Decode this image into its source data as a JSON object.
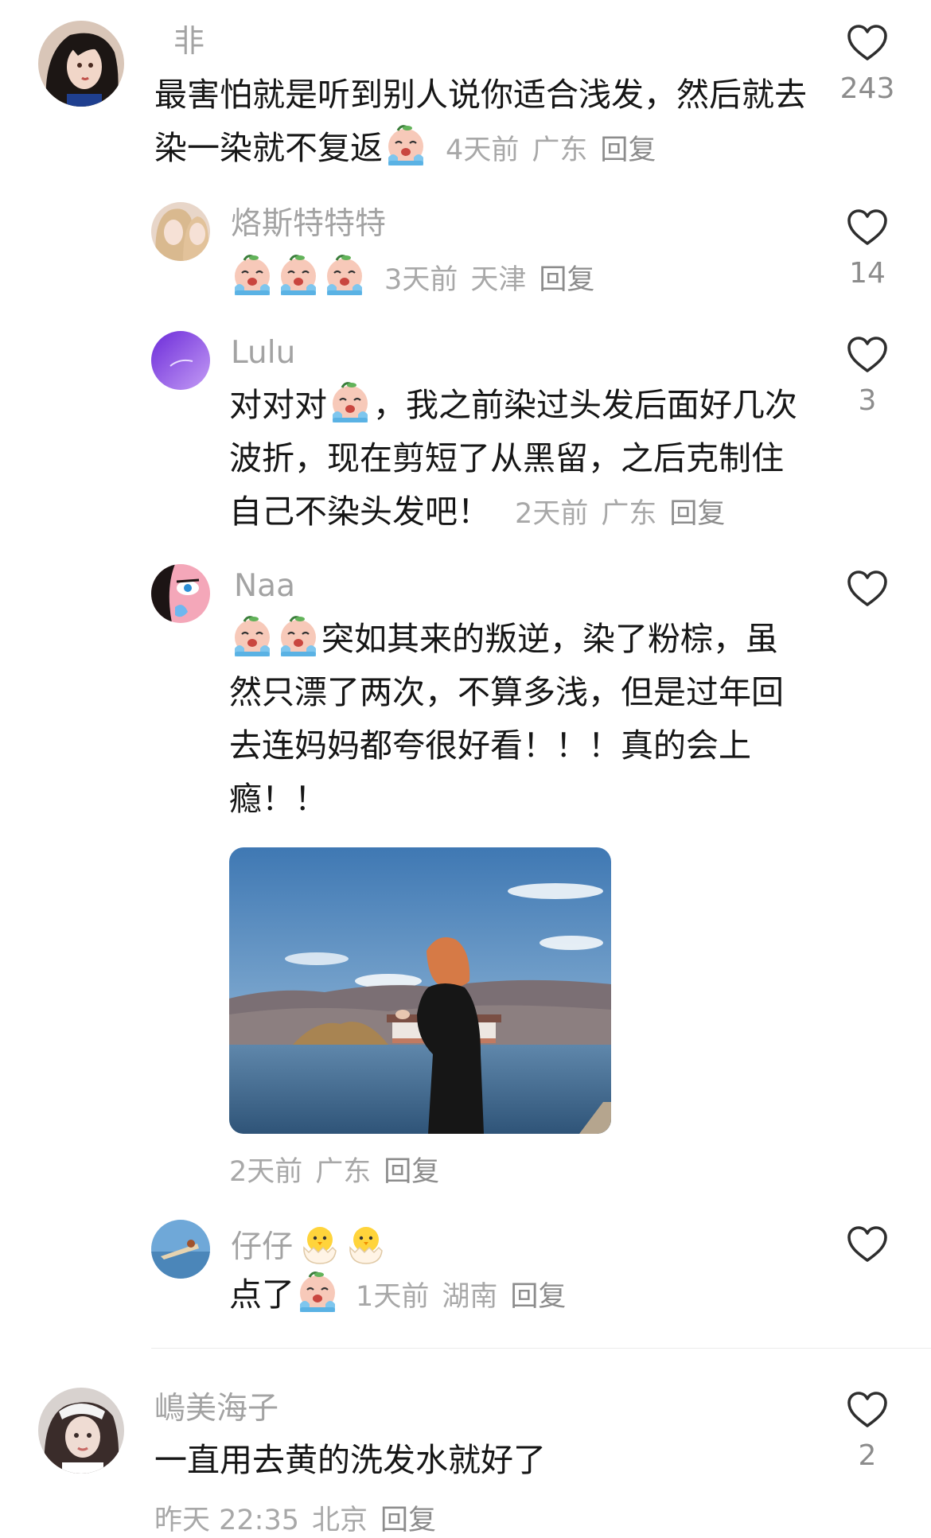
{
  "comments": [
    {
      "user": "非",
      "text_before_emoji": "最害怕就是听到别人说你适合浅发，然后就去染一染就不复返",
      "emoji": "crying-face-emoji",
      "time": "4天前",
      "location": "广东",
      "reply_label": "回复",
      "likes": "243"
    },
    {
      "user": "烙斯特特特",
      "emojis": [
        "crying-face-emoji",
        "crying-face-emoji",
        "crying-face-emoji"
      ],
      "time": "3天前",
      "location": "天津",
      "reply_label": "回复",
      "likes": "14"
    },
    {
      "user": "Lulu",
      "text_part1": "对对对",
      "emoji": "crying-face-emoji",
      "text_part2": "，我之前染过头发后面好几次波折，现在剪短了从黑留，之后克制住自己不染头发吧！",
      "time": "2天前",
      "location": "广东",
      "reply_label": "回复",
      "likes": "3"
    },
    {
      "user": "Naa",
      "emojis": [
        "crying-face-emoji",
        "crying-face-emoji"
      ],
      "text": "突如其来的叛逆，染了粉棕，虽然只漂了两次，不算多浅，但是过年回去连妈妈都夸很好看！！！真的会上瘾！！",
      "has_photo": true,
      "time": "2天前",
      "location": "广东",
      "reply_label": "回复"
    },
    {
      "user": "仔仔",
      "name_emojis": [
        "hatching-chick-emoji",
        "hatching-chick-emoji"
      ],
      "text": "点了",
      "emoji": "crying-face-emoji",
      "time": "1天前",
      "location": "湖南",
      "reply_label": "回复"
    },
    {
      "user": "嶋美海子",
      "text": "一直用去黄的洗发水就好了",
      "time": "昨天 22:35",
      "location": "北京",
      "reply_label": "回复",
      "likes": "2"
    }
  ],
  "colors": {
    "text": "#161616",
    "username": "#a3a3a3",
    "meta": "#a8a8a8"
  },
  "icons": {
    "like": "heart-outline-icon"
  }
}
